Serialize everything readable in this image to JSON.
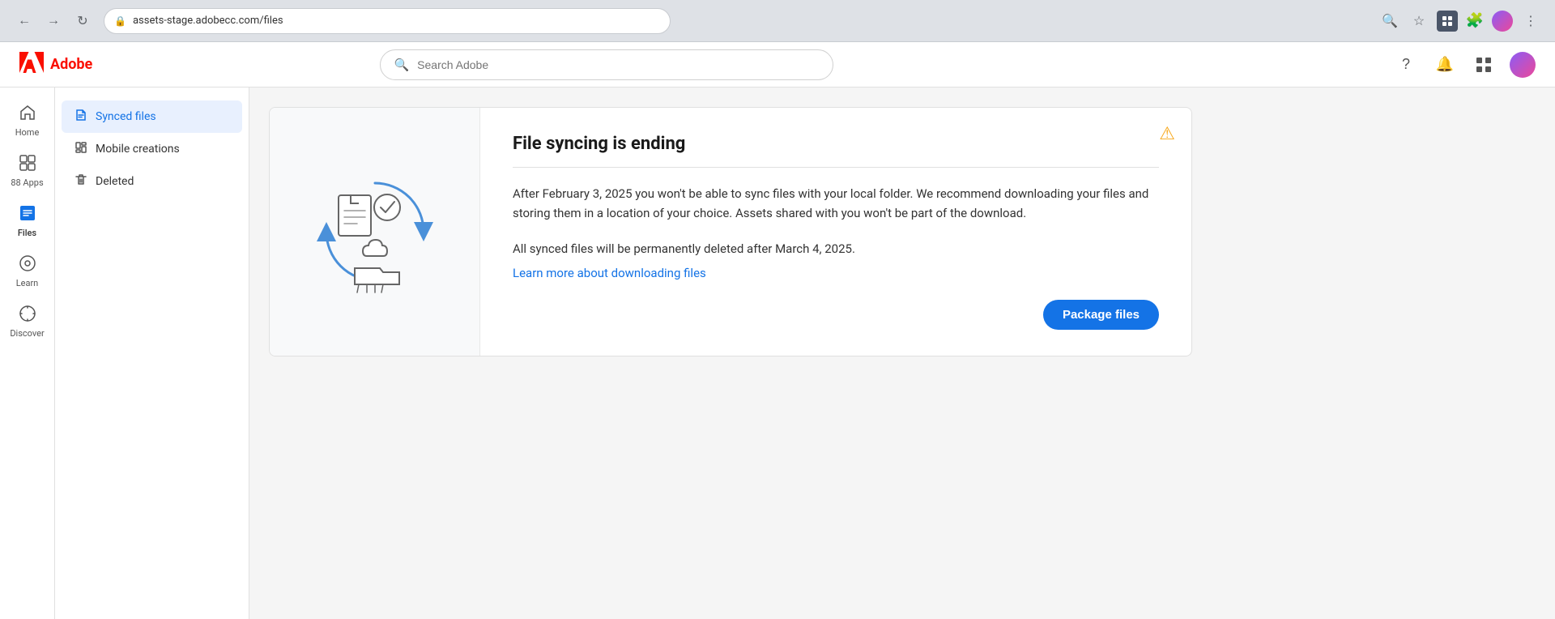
{
  "browser": {
    "back_label": "←",
    "forward_label": "→",
    "refresh_label": "↻",
    "url": "assets-stage.adobecc.com/files",
    "search_icon": "🔍",
    "star_icon": "☆"
  },
  "app": {
    "logo_text": "Adobe",
    "search_placeholder": "Search Adobe"
  },
  "icon_nav": {
    "items": [
      {
        "id": "home",
        "label": "Home",
        "icon": "⌂"
      },
      {
        "id": "apps",
        "label": "88 Apps",
        "icon": "⊞"
      },
      {
        "id": "files",
        "label": "Files",
        "icon": "▣",
        "active": true
      },
      {
        "id": "learn",
        "label": "Learn",
        "icon": "◎"
      },
      {
        "id": "discover",
        "label": "Discover",
        "icon": "◎"
      }
    ]
  },
  "sidebar": {
    "items": [
      {
        "id": "synced-files",
        "label": "Synced files",
        "icon": "📄",
        "active": true
      },
      {
        "id": "mobile-creations",
        "label": "Mobile creations",
        "icon": "📱"
      },
      {
        "id": "deleted",
        "label": "Deleted",
        "icon": "🗑"
      }
    ]
  },
  "notification": {
    "title": "File syncing is ending",
    "divider": true,
    "body": "After February 3, 2025 you won't be able to sync files with your local folder. We recommend downloading your files and storing them in a location of your choice. Assets shared with you won't be part of the download.",
    "sub_text": "All synced files will be permanently deleted after March 4, 2025.",
    "link_text": "Learn more about downloading files",
    "link_href": "#",
    "button_label": "Package files",
    "warning_icon": "⚠"
  }
}
